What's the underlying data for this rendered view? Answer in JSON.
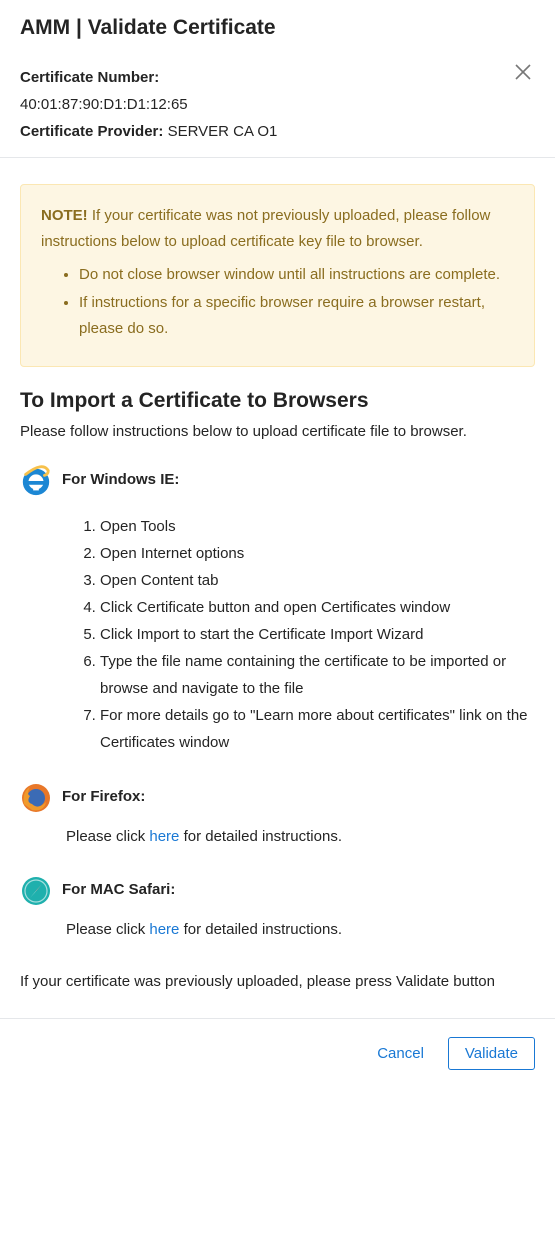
{
  "dialog": {
    "title": "AMM | Validate Certificate",
    "cert_number_label": "Certificate Number:",
    "cert_number_value": "40:01:87:90:D1:D1:12:65",
    "cert_provider_label": "Certificate Provider:",
    "cert_provider_value": "SERVER CA O1"
  },
  "note": {
    "label": "NOTE!",
    "text": " If your certificate was not previously uploaded, please follow instructions below to upload certificate key file to browser.",
    "bullets": [
      "Do not close browser window until all instructions are complete.",
      "If instructions for a specific browser require a browser restart, please do so."
    ]
  },
  "import": {
    "heading": "To Import a Certificate to Browsers",
    "sub": "Please follow instructions below to upload certificate file to browser."
  },
  "ie": {
    "heading": "For Windows IE:",
    "steps": [
      "Open Tools",
      "Open Internet options",
      "Open Content tab",
      "Click Certificate button and open Certificates window",
      "Click Import to start the Certificate Import Wizard",
      "Type the file name containing the certificate to be imported or browse and navigate to the file",
      "For more details go to \"Learn more about certificates\" link on the Certificates window"
    ]
  },
  "firefox": {
    "heading": "For Firefox:",
    "pre": "Please click ",
    "link": "here",
    "post": " for detailed instructions."
  },
  "safari": {
    "heading": "For MAC Safari:",
    "pre": "Please click ",
    "link": "here",
    "post": " for detailed instructions."
  },
  "bottom_note": "If your certificate was previously uploaded, please press Validate button",
  "footer": {
    "cancel": "Cancel",
    "validate": "Validate"
  }
}
